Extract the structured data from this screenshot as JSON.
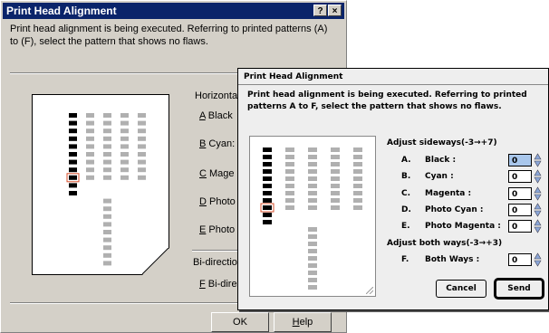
{
  "win": {
    "title": "Print Head Alignment",
    "help_glyph": "?",
    "close_glyph": "×",
    "description": "Print head alignment is being executed. Referring to printed patterns (A) to (F), select the pattern that shows no flaws.",
    "section_horizontal": "Horizontal",
    "items": [
      {
        "key": "A",
        "rest": " Black"
      },
      {
        "key": "B",
        "rest": " Cyan:"
      },
      {
        "key": "C",
        "rest": " Mage"
      },
      {
        "key": "D",
        "rest": " Photo"
      },
      {
        "key": "E",
        "rest": " Photo"
      }
    ],
    "section_bidirection": "Bi-direction",
    "bi_item": {
      "key": "F",
      "rest": " Bi-dire"
    },
    "ok_label": "OK",
    "help_key": "H",
    "help_rest": "elp"
  },
  "mac": {
    "title": "Print Head Alignment",
    "description": "Print head alignment is being executed. Referring to printed patterns A to F, select the pattern that shows no flaws.",
    "sideways_header": "Adjust sideways(-3→+7)",
    "both_header": "Adjust both ways(-3→+3)",
    "rows": [
      {
        "letter": "A.",
        "label": "Black :",
        "value": "0"
      },
      {
        "letter": "B.",
        "label": "Cyan :",
        "value": "0"
      },
      {
        "letter": "C.",
        "label": "Magenta :",
        "value": "0"
      },
      {
        "letter": "D.",
        "label": "Photo Cyan :",
        "value": "0"
      },
      {
        "letter": "E.",
        "label": "Photo Magenta :",
        "value": "0"
      }
    ],
    "both_row": {
      "letter": "F.",
      "label": "Both Ways :",
      "value": "0"
    },
    "cancel_label": "Cancel",
    "send_label": "Send"
  },
  "colors": {
    "win_face": "#d4d0c8",
    "win_title": "#0a246a",
    "highlight": "#d94f2b",
    "mac_face": "#eeeeee"
  }
}
